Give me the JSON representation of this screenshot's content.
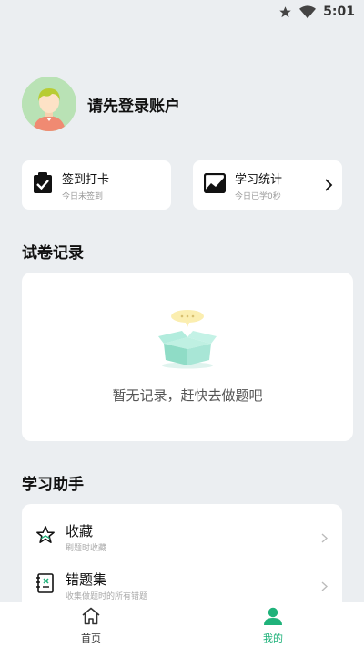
{
  "status_bar": {
    "time": "5:01"
  },
  "profile": {
    "login_prompt": "请先登录账户"
  },
  "quick_actions": [
    {
      "title": "签到打卡",
      "subtitle": "今日未签到"
    },
    {
      "title": "学习统计",
      "subtitle": "今日已学0秒"
    }
  ],
  "records": {
    "section_title": "试卷记录",
    "empty_text": "暂无记录，赶快去做题吧"
  },
  "assistant": {
    "section_title": "学习助手",
    "items": [
      {
        "title": "收藏",
        "subtitle": "刷题时收藏"
      },
      {
        "title": "错题集",
        "subtitle": "收集做题时的所有错题"
      }
    ]
  },
  "tabbar": {
    "tabs": [
      {
        "label": "首页",
        "icon": "home-icon",
        "active": false
      },
      {
        "label": "我的",
        "icon": "person-icon",
        "active": true
      }
    ]
  },
  "colors": {
    "accent": "#1fb27a",
    "background": "#ebeef1"
  }
}
